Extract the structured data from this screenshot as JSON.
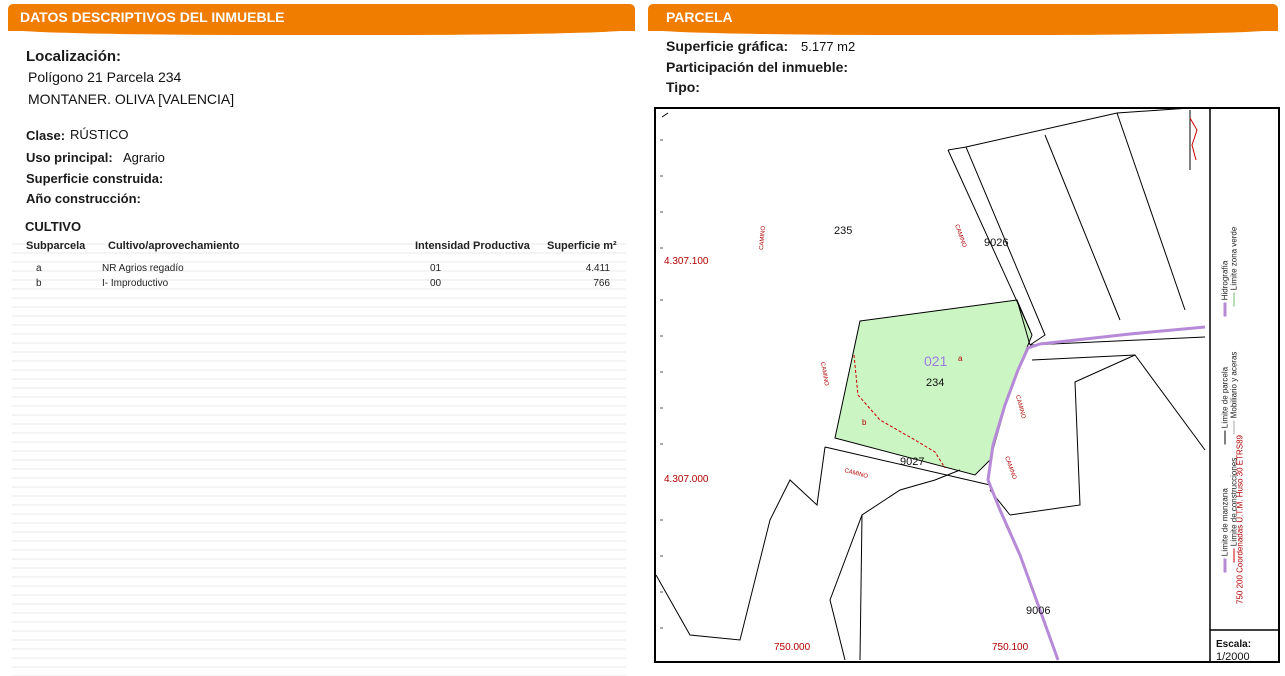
{
  "left_panel": {
    "title": "DATOS DESCRIPTIVOS DEL INMUEBLE",
    "localizacion_label": "Localización:",
    "address_line1": "Polígono 21 Parcela 234",
    "address_line2": "MONTANER. OLIVA [VALENCIA]",
    "clase_label": "Clase:",
    "clase_value": "RÚSTICO",
    "uso_label": "Uso principal:",
    "uso_value": "Agrario",
    "superficie_construida_label": "Superficie construida:",
    "anio_label": "Año construcción:",
    "cultivo_title": "CULTIVO",
    "table": {
      "headers": [
        "Subparcela",
        "Cultivo/aprovechamiento",
        "Intensidad Productiva",
        "Superficie m²"
      ],
      "rows": [
        [
          "a",
          "NR Agrios regadío",
          "01",
          "4.411"
        ],
        [
          "b",
          "I- Improductivo",
          "00",
          "766"
        ]
      ]
    }
  },
  "right_panel": {
    "title": "PARCELA",
    "superficie_grafica_label": "Superficie gráfica:",
    "superficie_grafica_value": "5.177 m2",
    "participacion_label": "Participación del inmueble:",
    "tipo_label": "Tipo:"
  },
  "map": {
    "coord_y_top": "4.307.100",
    "coord_y_bottom": "4.307.000",
    "coord_x_left": "750.000",
    "coord_x_right": "750.100",
    "parcel_235": "235",
    "parcel_234": "234",
    "parcel_code": "021",
    "sub_a": "a",
    "sub_b": "b",
    "road_9026": "9026",
    "road_9027": "9027",
    "road_9006": "9006",
    "camino": "CAMINO",
    "escala_label": "Escala:",
    "escala_value": "1/2000",
    "legend": {
      "limite_manzana": "Límite de manzana",
      "limite_parcela": "Límite de parcela",
      "hidrografia": "Hidrografía",
      "limite_construcciones": "Límite de construcciones",
      "mobiliario": "Mobiliario y aceras",
      "limite_zona_verde": "Límite zona verde",
      "coordenadas": "750 200 Coordenadas U.T.M. Huso 30 ETRS89"
    },
    "colors": {
      "parcel_fill": "#ccf5c4",
      "hydro": "#b78ad8",
      "construction": "#cc0000",
      "coord_text": "#b30000"
    }
  }
}
